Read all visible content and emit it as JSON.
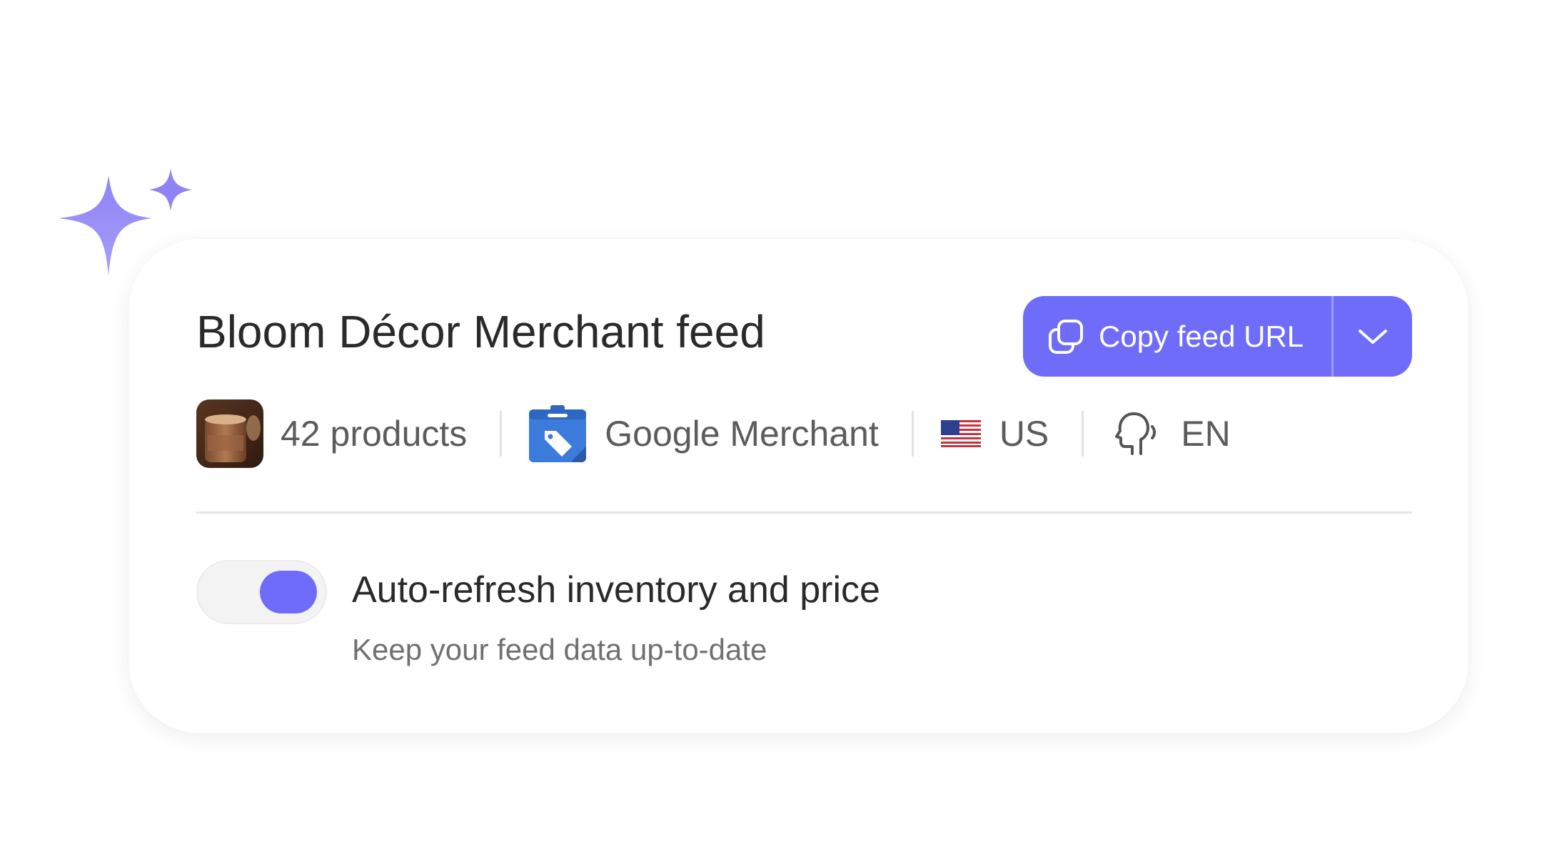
{
  "colors": {
    "accent": "#6e6cf8",
    "sparkle": "#8f86f5",
    "text_primary": "#2a2a2a",
    "text_secondary": "#5c5c5c"
  },
  "card": {
    "title": "Bloom Décor Merchant feed",
    "copy_button": {
      "label": "Copy feed URL",
      "icon": "copy-icon",
      "dropdown_icon": "chevron-down-icon"
    },
    "meta": {
      "products": "42 products",
      "thumbnail": "candle-product-thumbnail",
      "channel": "Google Merchant",
      "channel_icon": "google-merchant-icon",
      "country": "US",
      "country_icon": "us-flag-icon",
      "language": "EN",
      "language_icon": "speaking-head-icon"
    },
    "setting": {
      "enabled": true,
      "title": "Auto-refresh inventory and price",
      "subtitle": "Keep your feed data up-to-date"
    }
  }
}
